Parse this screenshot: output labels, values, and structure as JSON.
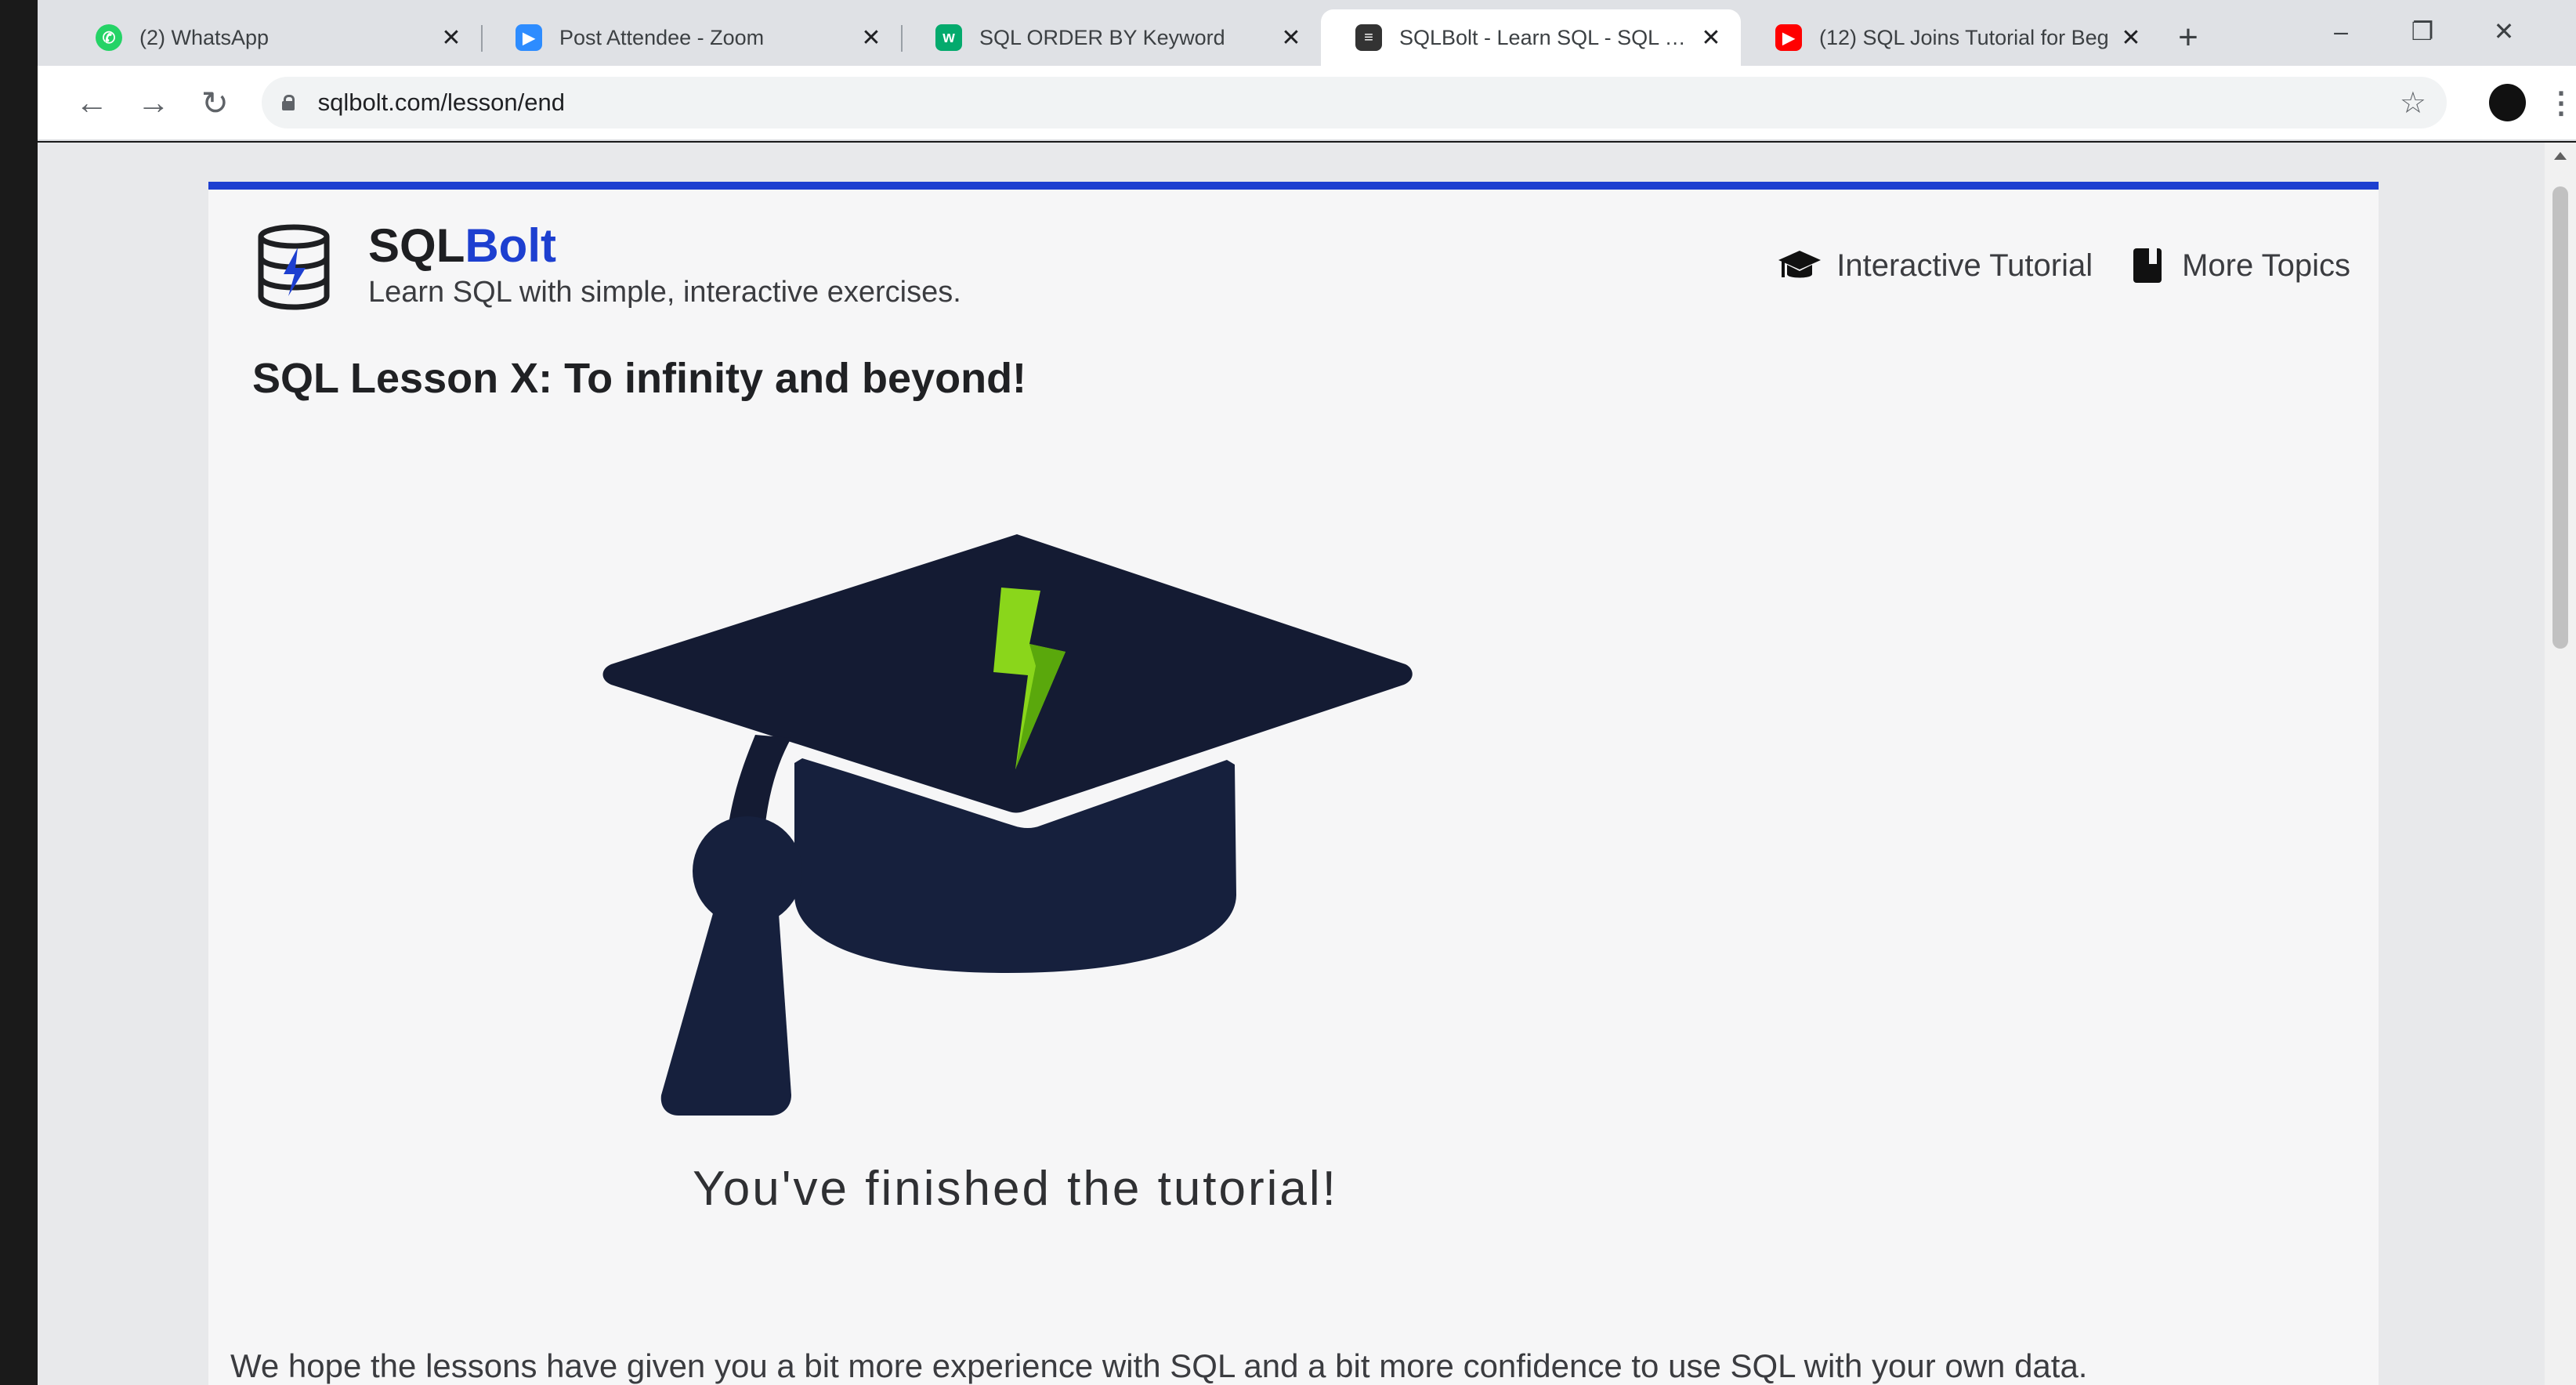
{
  "browser": {
    "tabs": [
      {
        "title": "(2) WhatsApp",
        "favicon_color": "#25d366",
        "active": false
      },
      {
        "title": "Post Attendee - Zoom",
        "favicon_color": "#2d8cff",
        "active": false
      },
      {
        "title": "SQL ORDER BY Keyword",
        "favicon_color": "#04aa6d",
        "active": false
      },
      {
        "title": "SQLBolt - Learn SQL - SQL Less",
        "favicon_color": "#333333",
        "active": true
      },
      {
        "title": "(12) SQL Joins Tutorial for Beg",
        "favicon_color": "#ff0000",
        "active": false
      }
    ],
    "url": "sqlbolt.com/lesson/end"
  },
  "site": {
    "brand_prefix": "SQL",
    "brand_accent": "Bolt",
    "tagline": "Learn SQL with simple, interactive exercises.",
    "nav": {
      "tutorial_label": "Interactive Tutorial",
      "topics_label": "More Topics"
    },
    "accent_color": "#1d3fd0"
  },
  "lesson": {
    "title": "SQL Lesson X: To infinity and beyond!",
    "finished_message": "You've finished the tutorial!",
    "closing_text": "We hope the lessons have given you a bit more experience with SQL and a bit more confidence to use SQL with your own data."
  }
}
